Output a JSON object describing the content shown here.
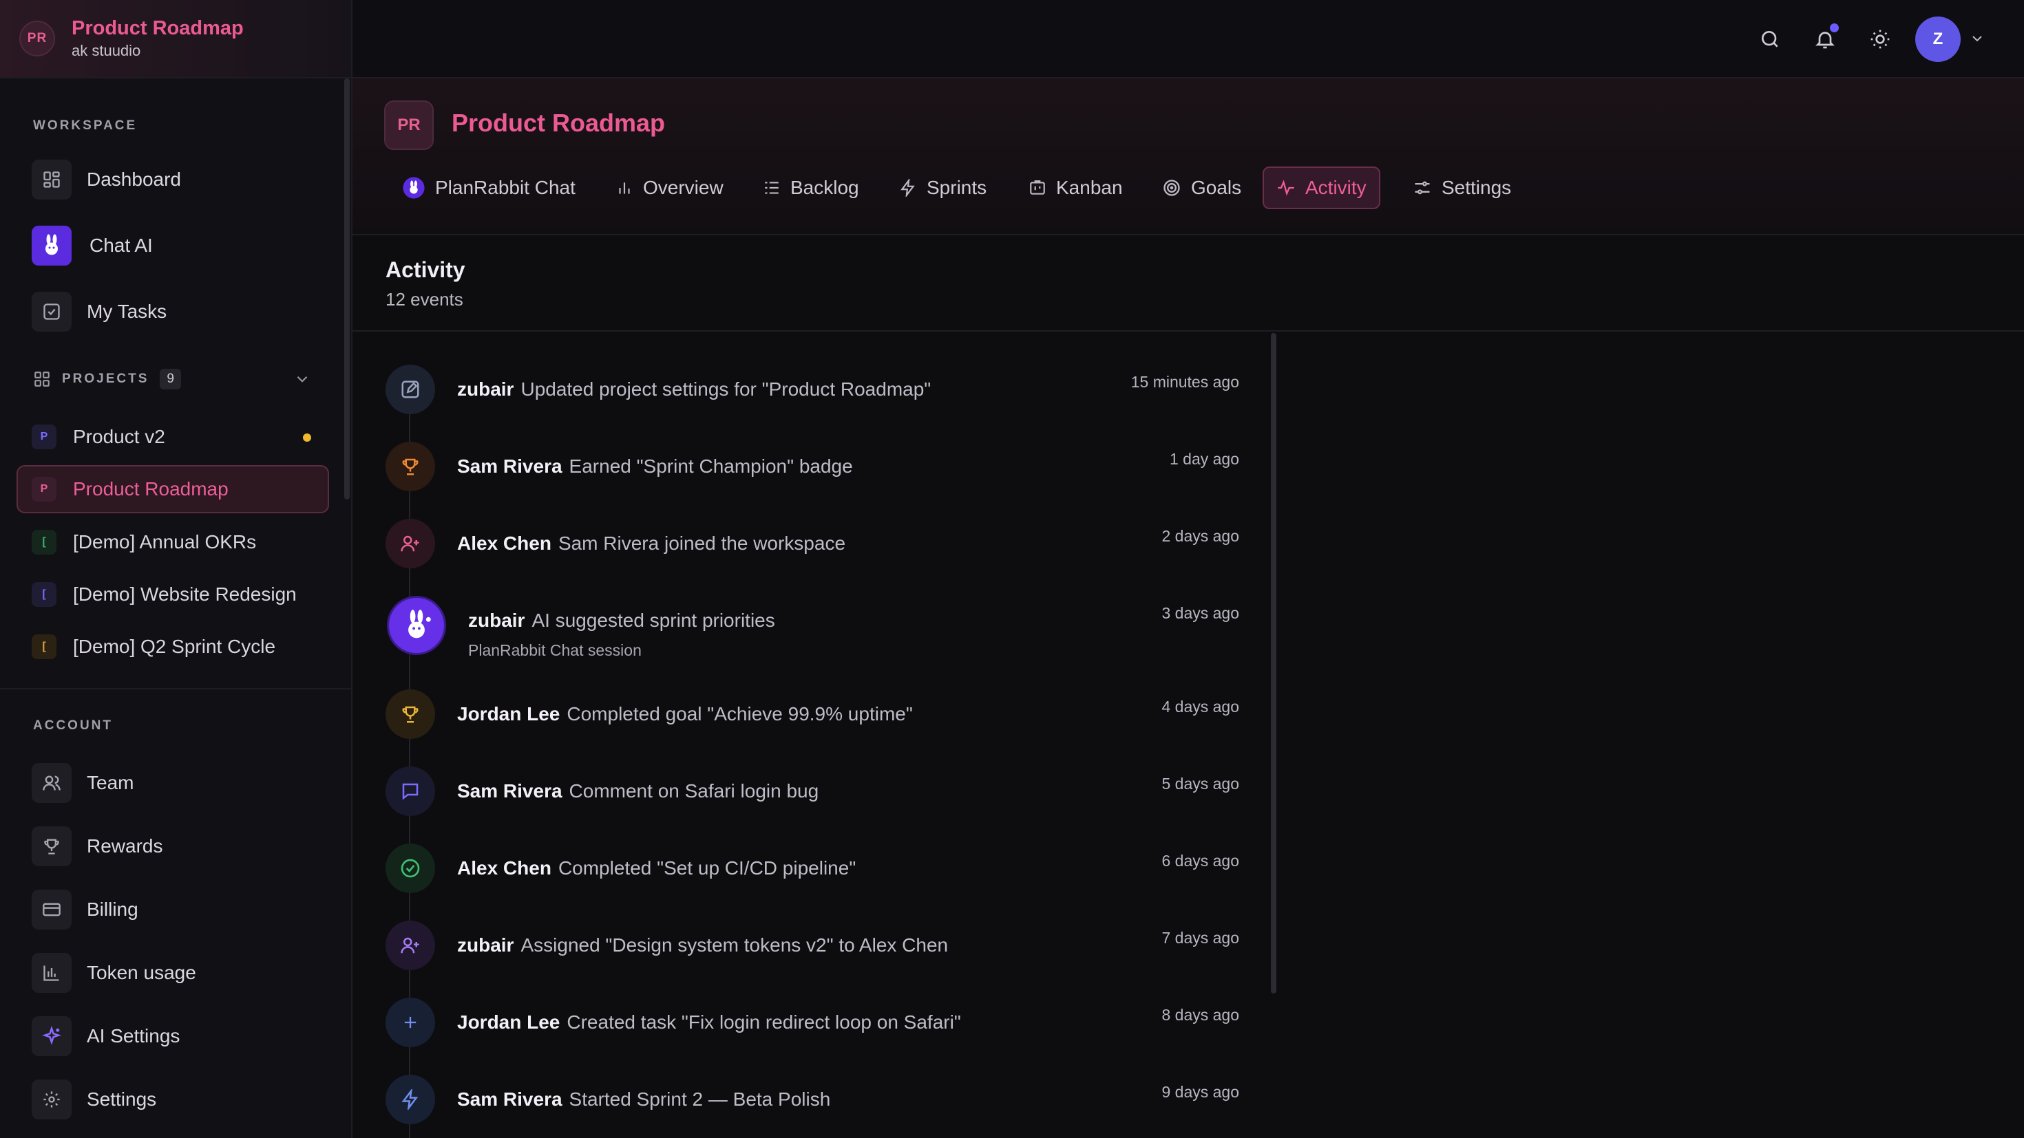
{
  "workspace": {
    "initials": "PR",
    "name": "Product Roadmap",
    "org": "ak stuudio"
  },
  "sidebar": {
    "workspace_label": "WORKSPACE",
    "workspace_items": [
      {
        "label": "Dashboard",
        "icon": "dashboard-icon"
      },
      {
        "label": "Chat AI",
        "icon": "planrabbit-logo-icon"
      },
      {
        "label": "My Tasks",
        "icon": "checkbox-icon"
      }
    ],
    "projects_label": "PROJECTS",
    "projects_count": "9",
    "projects": [
      {
        "initial": "P",
        "label": "Product v2",
        "color": "#6a5cff",
        "active": false,
        "dot": true
      },
      {
        "initial": "P",
        "label": "Product Roadmap",
        "color": "#e7608e",
        "active": true,
        "dot": false
      },
      {
        "initial": "[",
        "label": "[Demo] Annual OKRs",
        "color": "#3fae6a",
        "active": false,
        "dot": false
      },
      {
        "initial": "[",
        "label": "[Demo] Website Redesign",
        "color": "#6a5cff",
        "active": false,
        "dot": false
      },
      {
        "initial": "[",
        "label": "[Demo] Q2 Sprint Cycle",
        "color": "#e0a33a",
        "active": false,
        "dot": false
      }
    ],
    "account_label": "ACCOUNT",
    "account_items": [
      {
        "label": "Team",
        "icon": "users-icon"
      },
      {
        "label": "Rewards",
        "icon": "trophy-icon"
      },
      {
        "label": "Billing",
        "icon": "credit-card-icon"
      },
      {
        "label": "Token usage",
        "icon": "bar-chart-icon"
      },
      {
        "label": "AI Settings",
        "icon": "sparkle-icon"
      },
      {
        "label": "Settings",
        "icon": "gear-icon"
      }
    ]
  },
  "topbar": {
    "user_initial": "Z",
    "accent": "#5f56e6"
  },
  "project": {
    "initials": "PR",
    "title": "Product Roadmap",
    "tabs": [
      {
        "label": "PlanRabbit Chat",
        "icon": "planrabbit-logo-icon"
      },
      {
        "label": "Overview",
        "icon": "bar-chart-icon"
      },
      {
        "label": "Backlog",
        "icon": "list-icon"
      },
      {
        "label": "Sprints",
        "icon": "lightning-icon"
      },
      {
        "label": "Kanban",
        "icon": "kanban-icon"
      },
      {
        "label": "Goals",
        "icon": "target-icon"
      },
      {
        "label": "Activity",
        "icon": "activity-icon"
      },
      {
        "label": "Settings",
        "icon": "sliders-icon"
      }
    ],
    "active_tab": "Activity"
  },
  "activity": {
    "title": "Activity",
    "count_label": "12 events",
    "events": [
      {
        "actor": "zubair",
        "text": "Updated project settings for \"Product Roadmap\"",
        "time": "15 minutes ago",
        "icon": "edit-icon"
      },
      {
        "actor": "Sam Rivera",
        "text": "Earned \"Sprint Champion\" badge",
        "time": "1 day ago",
        "icon": "trophy-icon"
      },
      {
        "actor": "Alex Chen",
        "text": "Sam Rivera joined the workspace",
        "time": "2 days ago",
        "icon": "user-plus-icon"
      },
      {
        "actor": "zubair",
        "text": "AI suggested sprint priorities",
        "sub": "PlanRabbit Chat session",
        "time": "3 days ago",
        "icon": "planrabbit-logo-icon"
      },
      {
        "actor": "Jordan Lee",
        "text": "Completed goal \"Achieve 99.9% uptime\"",
        "time": "4 days ago",
        "icon": "trophy-icon"
      },
      {
        "actor": "Sam Rivera",
        "text": "Comment on Safari login bug",
        "time": "5 days ago",
        "icon": "comment-icon"
      },
      {
        "actor": "Alex Chen",
        "text": "Completed \"Set up CI/CD pipeline\"",
        "time": "6 days ago",
        "icon": "check-circle-icon"
      },
      {
        "actor": "zubair",
        "text": "Assigned \"Design system tokens v2\" to Alex Chen",
        "time": "7 days ago",
        "icon": "user-plus-icon"
      },
      {
        "actor": "Jordan Lee",
        "text": "Created task \"Fix login redirect loop on Safari\"",
        "time": "8 days ago",
        "icon": "plus-icon"
      },
      {
        "actor": "Sam Rivera",
        "text": "Started Sprint 2 — Beta Polish",
        "time": "9 days ago",
        "icon": "lightning-icon"
      }
    ]
  }
}
